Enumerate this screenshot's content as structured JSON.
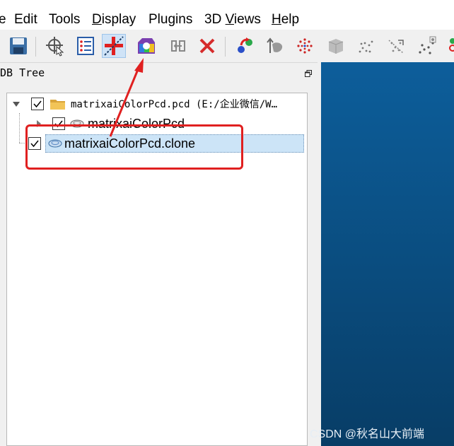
{
  "menu": {
    "items": [
      {
        "label": "e",
        "underline": ""
      },
      {
        "label": "Edit",
        "underline": ""
      },
      {
        "label": "Tools",
        "underline": ""
      },
      {
        "label": "isplay",
        "underline": "D"
      },
      {
        "label": "Plugins",
        "underline": ""
      },
      {
        "label": "3D ",
        "underline": "",
        "suffix_u": "V",
        "suffix": "iews"
      },
      {
        "label": "elp",
        "underline": "H"
      }
    ]
  },
  "toolbar": {
    "buttons": [
      {
        "name": "save-icon"
      },
      {
        "name": "point-picking-icon"
      },
      {
        "name": "list-properties-icon"
      },
      {
        "name": "translate-rotate-icon",
        "active": true
      },
      {
        "name": "color-scalar-icon"
      },
      {
        "name": "segment-icon"
      },
      {
        "name": "delete-icon"
      },
      {
        "name": "registration-icon"
      },
      {
        "name": "normals-icon"
      },
      {
        "name": "sample-points-icon"
      },
      {
        "name": "mesh-icon"
      },
      {
        "name": "subsample-icon"
      },
      {
        "name": "noise-filter-icon"
      },
      {
        "name": "sparse-cloud-icon"
      },
      {
        "name": "more-icon"
      }
    ]
  },
  "db_tree": {
    "title": "DB Tree",
    "rows": [
      {
        "label": "matrixaiColorPcd.pcd (E:/企业微信/W…",
        "checked": true
      },
      {
        "label": "matrixaiColorPcd",
        "checked": true
      },
      {
        "label": "matrixaiColorPcd.clone",
        "checked": true,
        "selected": true
      }
    ]
  },
  "watermark": "CSDN @秋名山大前端",
  "colors": {
    "annotation_red": "#e02020",
    "view_background": "#0a4c7e",
    "selection": "#cce4f7"
  }
}
